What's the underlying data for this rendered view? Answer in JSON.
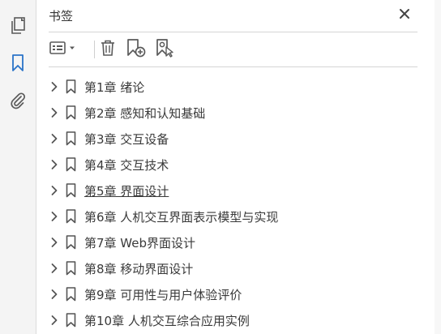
{
  "left_rail": {
    "items": [
      {
        "name": "pages",
        "icon": "copy-pages-icon",
        "active": false
      },
      {
        "name": "bookmarks",
        "icon": "bookmark-icon",
        "active": true
      },
      {
        "name": "attachments",
        "icon": "paperclip-icon",
        "active": false
      }
    ]
  },
  "panel": {
    "title": "书签",
    "close_icon": "close-icon"
  },
  "toolbar": {
    "options_icon": "list-options-icon",
    "delete_icon": "trash-icon",
    "new_bookmark_icon": "add-bookmark-icon",
    "from_structure_icon": "bookmark-cursor-icon"
  },
  "bookmarks": [
    {
      "label": "第1章  绪论",
      "underlined": false
    },
    {
      "label": "第2章  感知和认知基础",
      "underlined": false
    },
    {
      "label": "第3章  交互设备",
      "underlined": false
    },
    {
      "label": "第4章  交互技术",
      "underlined": false
    },
    {
      "label": "第5章  界面设计",
      "underlined": true
    },
    {
      "label": "第6章  人机交互界面表示模型与实现",
      "underlined": false
    },
    {
      "label": "第7章  Web界面设计",
      "underlined": false
    },
    {
      "label": "第8章  移动界面设计",
      "underlined": false
    },
    {
      "label": "第9章  可用性与用户体验评价",
      "underlined": false
    },
    {
      "label": "第10章  人机交互综合应用实例",
      "underlined": false
    }
  ],
  "colors": {
    "accent": "#2a73c8",
    "icon_gray": "#5a5a5a"
  }
}
